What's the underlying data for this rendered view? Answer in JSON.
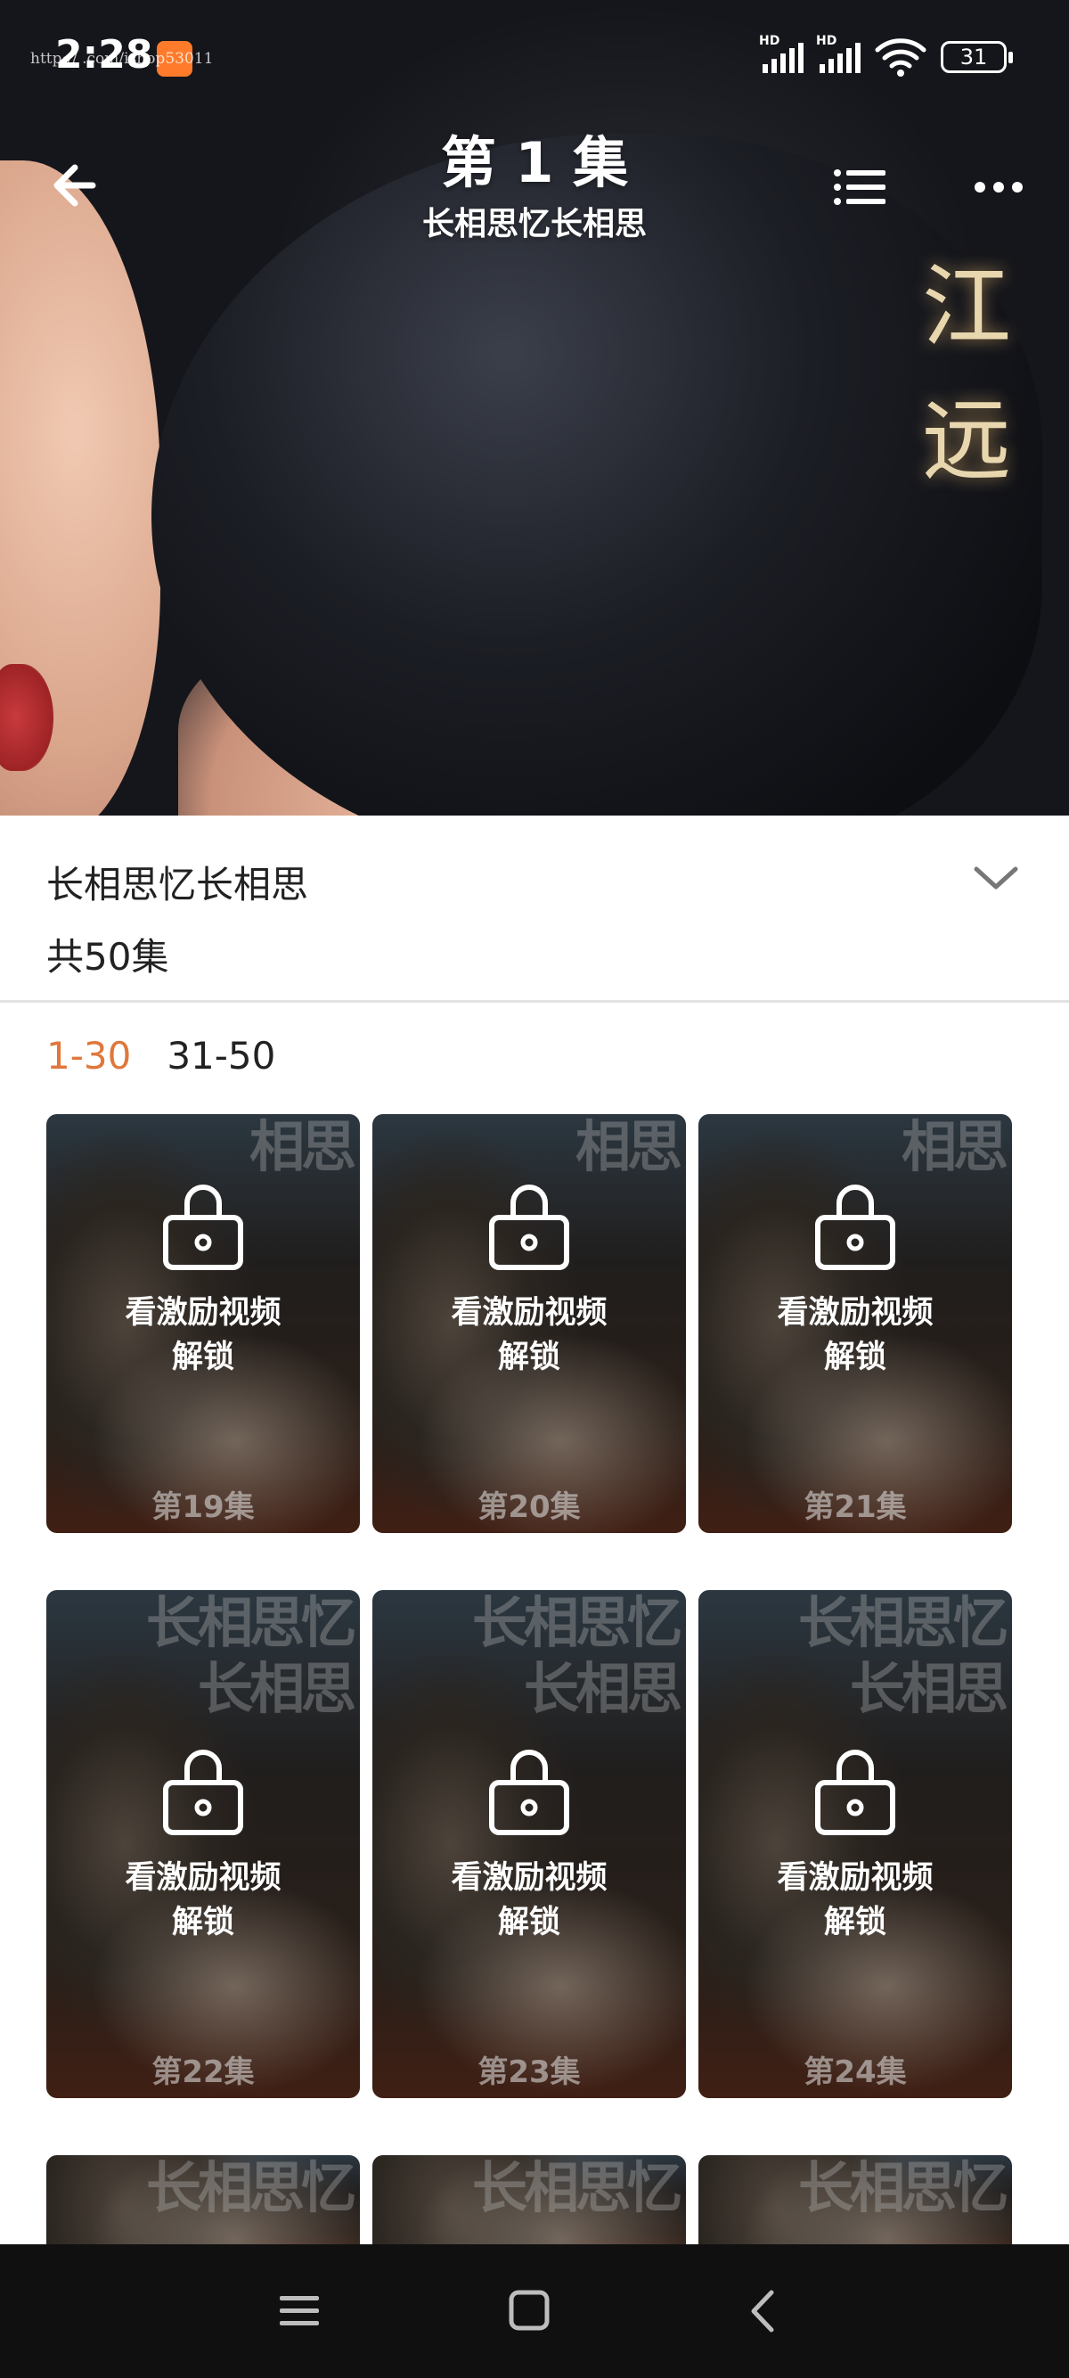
{
  "status_bar": {
    "time": "2:28",
    "watermark": "http://                .com/ishop53011",
    "signal1_label": "HD",
    "signal2_label": "HD",
    "battery": "31"
  },
  "video": {
    "overlay_chars": "江\n远"
  },
  "header": {
    "episode_title": "第 1 集",
    "show_title": "长相思忆长相思"
  },
  "info": {
    "title": "长相思忆长相思",
    "episode_count": "共50集"
  },
  "tabs": [
    {
      "label": "1-30",
      "active": true
    },
    {
      "label": "31-50",
      "active": false
    }
  ],
  "episodes": [
    {
      "label": "第19集",
      "unlock_line1": "看激励视频",
      "unlock_line2": "解锁",
      "poster": "相思"
    },
    {
      "label": "第20集",
      "unlock_line1": "看激励视频",
      "unlock_line2": "解锁",
      "poster": "相思"
    },
    {
      "label": "第21集",
      "unlock_line1": "看激励视频",
      "unlock_line2": "解锁",
      "poster": "相思"
    },
    {
      "label": "第22集",
      "unlock_line1": "看激励视频",
      "unlock_line2": "解锁",
      "poster": "长相思忆\n长相思"
    },
    {
      "label": "第23集",
      "unlock_line1": "看激励视频",
      "unlock_line2": "解锁",
      "poster": "长相思忆\n长相思"
    },
    {
      "label": "第24集",
      "unlock_line1": "看激励视频",
      "unlock_line2": "解锁",
      "poster": "长相思忆\n长相思"
    },
    {
      "label": "",
      "unlock_line1": "",
      "unlock_line2": "",
      "poster": "长相思忆"
    },
    {
      "label": "",
      "unlock_line1": "",
      "unlock_line2": "",
      "poster": "长相思忆"
    },
    {
      "label": "",
      "unlock_line1": "",
      "unlock_line2": "",
      "poster": "长相思忆"
    }
  ],
  "colors": {
    "tab_active": "#e0773c",
    "nav_bg": "#101010"
  }
}
